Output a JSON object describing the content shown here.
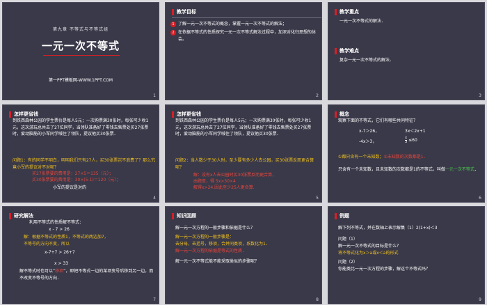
{
  "slide1": {
    "subtitle": "第九章 不等式与不等式组",
    "title": "一元一次不等式",
    "footer": "第一PPT模板网-WWW.1PPT.COM",
    "num": "1"
  },
  "slide2": {
    "heading": "教学目标",
    "goals": [
      {
        "n": "1",
        "text": "了解一元一次不等式的概念，掌握一元一次不等式的解法；"
      },
      {
        "n": "2",
        "text": "在依据不等式的性质探究一元一次不等式解法过程中，加深对化归思想的体会。"
      }
    ],
    "num": "2"
  },
  "slide3": {
    "heading1": "教学重点",
    "text1": "一元一次不等式的解法．",
    "heading2": "教学难点",
    "text2": "复杂一元一次不等式的解法．",
    "num": "3"
  },
  "slide4": {
    "heading": "怎样更省钱",
    "story": "到铁西森林公园的学生票价是每人5元；一次购票满30张时，每张可少收1元，这次游玩总共去了27位同学，当领队准备好了零钱去售票处买27张票时，爱动脑筋的小军同学喊住了领队，提议他买30张票．",
    "question": "问题1：有的同学不明白，明明我们只有27人，买30张票岂不浪费了？那么究竟小军的提议对不对呢？",
    "calc1": "买27张票要的费用是：27×5＝135（元）；",
    "calc2": "买30张票要的费用是：30×(5-1)＝120（元）；",
    "conclusion": "小军的提议是对的",
    "num": "4"
  },
  "slide5": {
    "heading": "怎样更省钱",
    "story": "到铁西森林公园的学生票价是每人5元；一次购票满30张时，每张可少收1元，这次游玩总共去了27位同学，当领队准备好了零钱去售票处买27张票时，爱动脑筋的小军同学喊住了领队，提议他买30张票．",
    "question": "问题2：当人数少于30人时，至少要有多少人去公园，买30张票反而更合算呢？",
    "ans1": "解：设有x人去公园时买30张票反而更合算，",
    "ans2": "由题意，得 5x>30×4",
    "ans3": "解得x>24.因此至少25人更合算.",
    "num": "5"
  },
  "slide6": {
    "heading": "概念",
    "intro": "观察下面的不等式，它们有哪些共同特征？",
    "ineq1": "x-7＞26，",
    "ineq2": "3x＜2x+1",
    "ineq3": "-4x＞3，",
    "frac_top": "x",
    "frac_bottom": "3",
    "ineq4": "≤60",
    "feat1": "①都只含有一个未知数；",
    "feat2": "②未知数的次数都是1．",
    "def_white": "只含有一个未知数，且未知数的次数都是1的不等式，叫做",
    "def_green": "一元一次不等式",
    "def_end": "．",
    "num": "6"
  },
  "slide7": {
    "heading": "研究解法",
    "intro": "利用不等式的性质解不等式：",
    "eq1": "x - 7 > 26",
    "step_yellow": "解：根据不等式的性质1，不等式的两边加7，",
    "step_yellow2": "不等号的方向不变，所以",
    "eq2": "x-7+7 > 26+7",
    "eq3": "x > 33",
    "note1": "解不等式时也可以“",
    "note_red": "移项",
    "note2": "”，即把不等式一边的某项变号后移到另一边，而不改变不等号的方向．",
    "num": "7"
  },
  "slide8": {
    "heading": "知识回顾",
    "q1": "解一元一次方程的一般步骤和依据是什么？",
    "a1": "解一元一次方程的一般步骤是：",
    "a2": "去分母，去括号，移项，合并同类项，系数化为1．",
    "a3": "解一元一次方程的依据是等式的性质．",
    "q2": "解一元一次不等式能不能采取类似的步骤呢？",
    "num": "8"
  },
  "slide9": {
    "heading": "例题",
    "task": "解下列不等式，并在数轴上表示解集（1）2(1+x)＜3",
    "p1": "问题（1）",
    "p1q": "解一元一次不等式的目标是什么？",
    "p1a": "将不等式化为x＞a或x＜a的形式",
    "p2": "问题（2）",
    "p2q": "你能类比一元一次方程的步骤，解这个不等式吗？",
    "num": "9"
  },
  "colors": {
    "slide_bg": "#3a3949",
    "accent_red": "#d81f26",
    "highlight_yellow": "#f2c21c",
    "highlight_red": "#e8463c",
    "highlight_green": "#49c54e"
  }
}
